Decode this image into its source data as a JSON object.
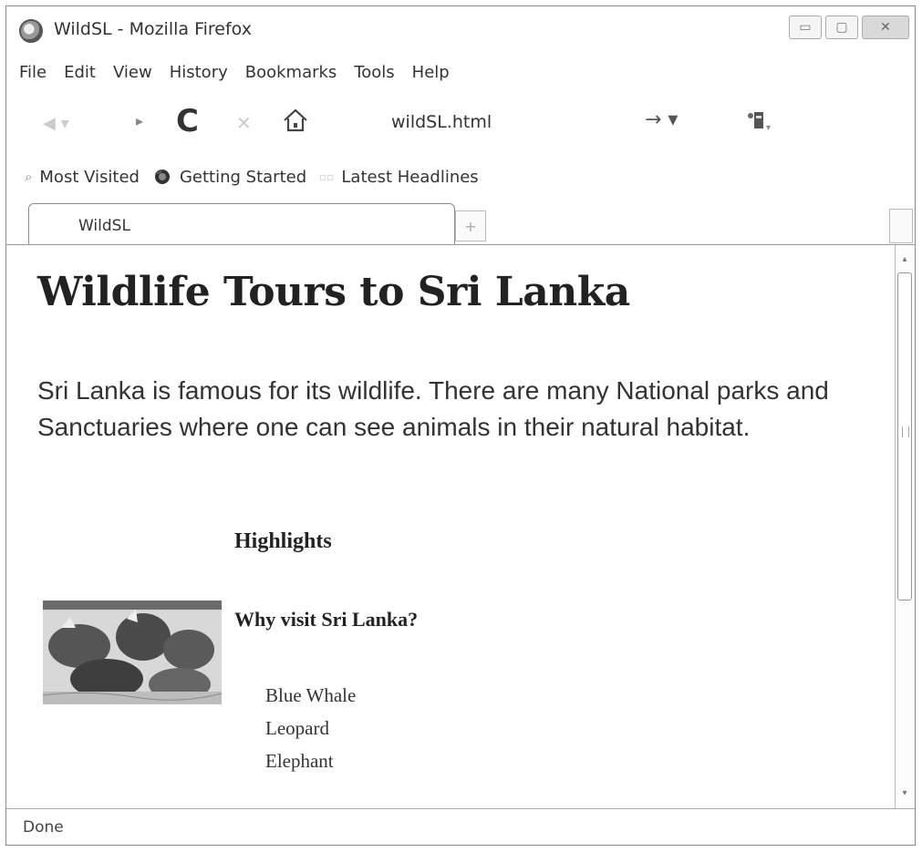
{
  "window": {
    "title": "WildSL - Mozilla Firefox",
    "controls": [
      "▭",
      "▢",
      "✕"
    ]
  },
  "menubar": {
    "items": [
      "File",
      "Edit",
      "View",
      "History",
      "Bookmarks",
      "Tools",
      "Help"
    ]
  },
  "navbar": {
    "url": "wildSL.html",
    "icons": {
      "back": "back-arrow-icon",
      "forward": "forward-arrow-icon",
      "reload": "reload-icon",
      "stop": "stop-icon",
      "home": "home-icon",
      "go": "go-arrow-icon",
      "addon": "addon-icon"
    }
  },
  "bookmarks": {
    "items": [
      "Most Visited",
      "Getting Started",
      "Latest Headlines"
    ]
  },
  "tabs": [
    {
      "label": "WildSL"
    }
  ],
  "page": {
    "heading": "Wildlife Tours to Sri Lanka",
    "intro": "Sri Lanka is famous for its wildlife. There are many National parks and Sanctuaries where one can see animals in their natural habitat.",
    "highlights_heading": "Highlights",
    "image_subject": "elephants-photo",
    "why_heading": "Why visit Sri Lanka?",
    "animals": [
      "Blue Whale",
      "Leopard",
      "Elephant"
    ]
  },
  "status": {
    "text": "Done"
  }
}
